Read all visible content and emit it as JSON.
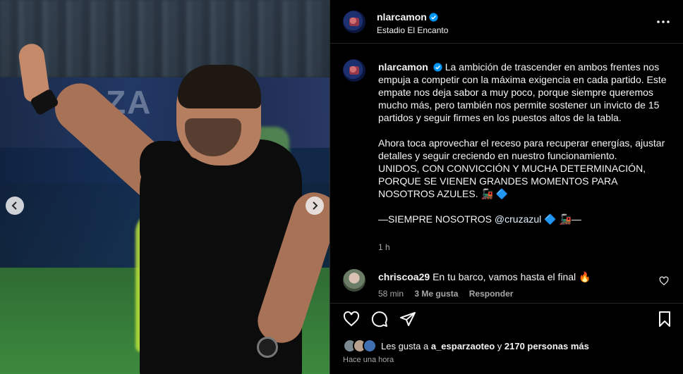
{
  "post": {
    "author": "nlarcamon",
    "location": "Estadio El Encanto"
  },
  "caption": {
    "username": "nlarcamon",
    "body": "La ambición de trascender en ambos frentes nos empuja a competir con la máxima exigencia en cada partido. Este empate nos deja sabor a muy poco, porque siempre queremos mucho más, pero también nos permite sostener un invicto de 15 partidos y seguir firmes en los puestos altos de la tabla.\n\nAhora toca aprovechar el receso para recuperar energías, ajustar detalles y seguir creciendo en nuestro funcionamiento.\nUNIDOS, CON CONVICCIÓN Y MUCHA DETERMINACIÓN, PORQUE SE VIENEN GRANDES MOMENTOS PARA NOSOTROS AZULES. 🚂 🔷",
    "signature_before": "—SIEMPRE NOSOTROS ",
    "mention": "@cruzazul",
    "signature_after": " 🔷 🚂—",
    "time": "1 h"
  },
  "comment": {
    "username": "chriscoa29",
    "text": "En tu barco, vamos hasta el final 🔥",
    "time": "58 min",
    "likes": "3 Me gusta",
    "reply": "Responder"
  },
  "likes": {
    "prefix": "Les gusta a ",
    "user": "a_esparzaoteo",
    "middle": " y ",
    "count": "2170 personas más"
  },
  "post_time": "Hace una hora",
  "media": {
    "banner_text": "ZA"
  },
  "icons": {
    "verified": "verified-badge-icon",
    "more": "more-options-icon",
    "like": "heart-icon",
    "comment": "comment-icon",
    "share": "send-icon",
    "save": "bookmark-icon",
    "prev": "chevron-left-icon",
    "next": "chevron-right-icon"
  },
  "colors": {
    "verified": "#0095f6",
    "background": "#000000",
    "secondary_text": "#a8a8a8",
    "mention": "#e0f1ff"
  }
}
